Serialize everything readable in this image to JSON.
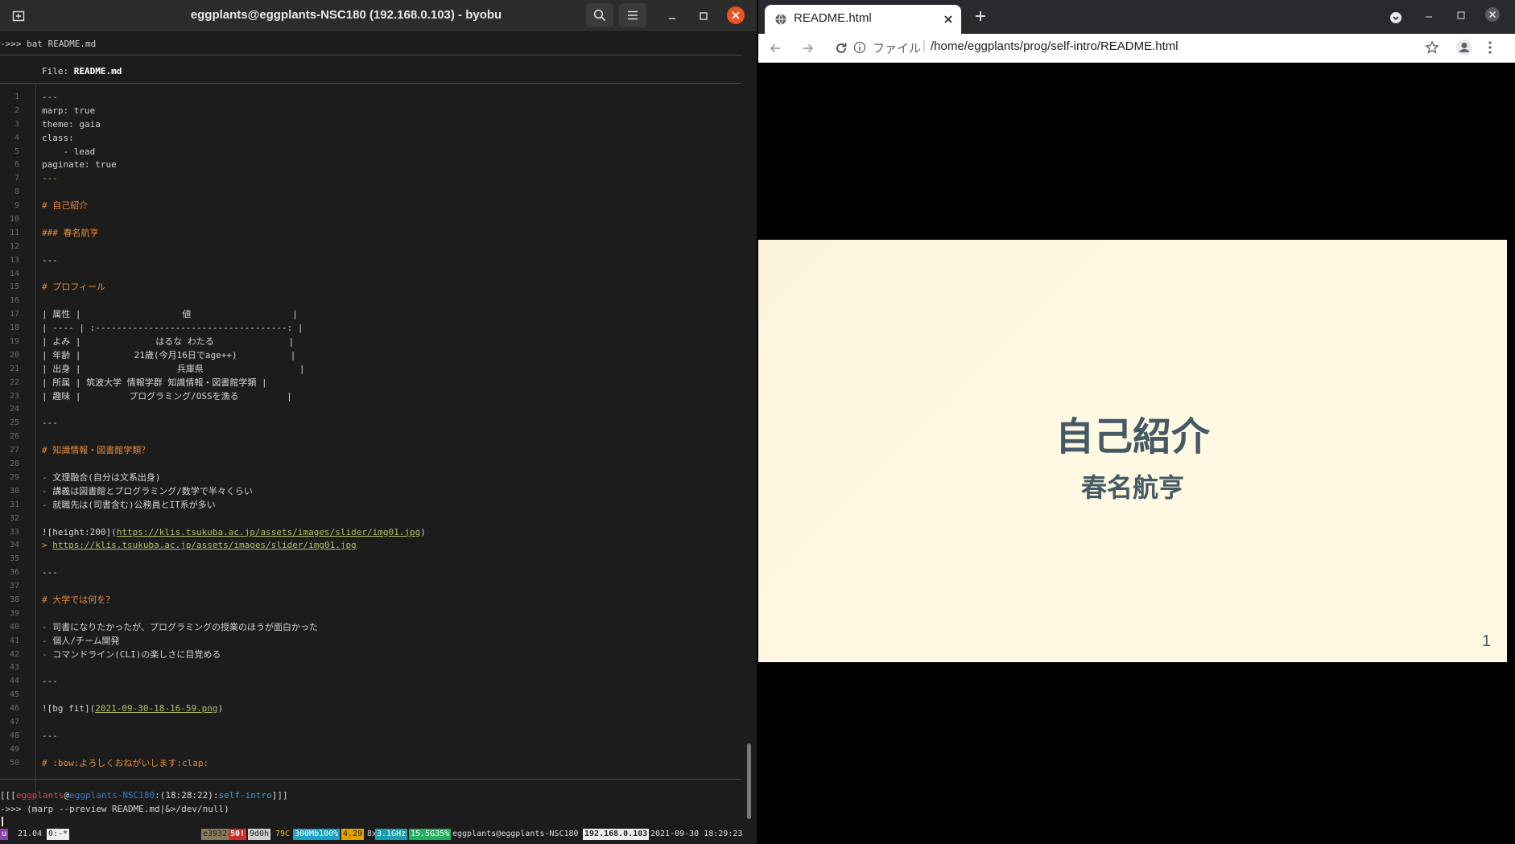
{
  "terminal": {
    "title": "eggplants@eggplants-NSC180 (192.168.0.103) - byobu",
    "command": "->>> bat README.md",
    "file_label": "File: ",
    "file_name": "README.md",
    "lines": [
      {
        "n": "1",
        "t": "---",
        "c": "txt"
      },
      {
        "n": "2",
        "t": "marp: true",
        "c": "txt"
      },
      {
        "n": "3",
        "t": "theme: gaia",
        "c": "txt"
      },
      {
        "n": "4",
        "t": "class:",
        "c": "txt"
      },
      {
        "n": "5",
        "t": "    - lead",
        "c": "txt"
      },
      {
        "n": "6",
        "t": "paginate: true",
        "c": "txt"
      },
      {
        "n": "7",
        "t": "---",
        "c": "dash"
      },
      {
        "n": "8",
        "t": "",
        "c": "txt"
      },
      {
        "n": "9",
        "t": "# 自己紹介",
        "c": "h1"
      },
      {
        "n": "10",
        "t": "",
        "c": "txt"
      },
      {
        "n": "11",
        "t": "### 春名航亨",
        "c": "h1"
      },
      {
        "n": "12",
        "t": "",
        "c": "txt"
      },
      {
        "n": "13",
        "t": "---",
        "c": "txt"
      },
      {
        "n": "14",
        "t": "",
        "c": "txt"
      },
      {
        "n": "15",
        "t": "# プロフィール",
        "c": "h1"
      },
      {
        "n": "16",
        "t": "",
        "c": "txt"
      },
      {
        "n": "17",
        "t": "| 属性 |                   値                   |",
        "c": "txt"
      },
      {
        "n": "18",
        "t": "| ---- | :------------------------------------: |",
        "c": "txt"
      },
      {
        "n": "19",
        "t": "| よみ |              はるな わたる              |",
        "c": "txt"
      },
      {
        "n": "20",
        "t": "| 年齢 |          21歳(今月16日でage++)          |",
        "c": "txt"
      },
      {
        "n": "21",
        "t": "| 出身 |                  兵庫県                  |",
        "c": "txt"
      },
      {
        "n": "22",
        "t": "| 所属 | 筑波大学 情報学群 知識情報・図書館学類 |",
        "c": "txt"
      },
      {
        "n": "23",
        "t": "| 趣味 |         プログラミング/OSSを漁る         |",
        "c": "txt"
      },
      {
        "n": "24",
        "t": "",
        "c": "txt"
      },
      {
        "n": "25",
        "t": "---",
        "c": "txt"
      },
      {
        "n": "26",
        "t": "",
        "c": "txt"
      },
      {
        "n": "27",
        "t": "# 知識情報・図書館学類？",
        "c": "h1"
      },
      {
        "n": "28",
        "t": "",
        "c": "txt"
      },
      {
        "n": "29",
        "t": "- 文理融合(自分は文系出身)",
        "c": "bul"
      },
      {
        "n": "30",
        "t": "- 講義は図書館とプログラミング/数学で半々くらい",
        "c": "bul"
      },
      {
        "n": "31",
        "t": "- 就職先は(司書含む)公務員とIT系が多い",
        "c": "bul"
      },
      {
        "n": "32",
        "t": "",
        "c": "txt"
      },
      {
        "n": "33",
        "t": "![height:200](https://klis.tsukuba.ac.jp/assets/images/slider/img01.jpg)",
        "c": "img"
      },
      {
        "n": "34",
        "t": "> https://klis.tsukuba.ac.jp/assets/images/slider/img01.jpg",
        "c": "quote"
      },
      {
        "n": "35",
        "t": "",
        "c": "txt"
      },
      {
        "n": "36",
        "t": "---",
        "c": "txt"
      },
      {
        "n": "37",
        "t": "",
        "c": "txt"
      },
      {
        "n": "38",
        "t": "# 大学では何を？",
        "c": "h1"
      },
      {
        "n": "39",
        "t": "",
        "c": "txt"
      },
      {
        "n": "40",
        "t": "- 司書になりたかったが、プログラミングの授業のほうが面白かった",
        "c": "bul"
      },
      {
        "n": "41",
        "t": "- 個人/チーム開発",
        "c": "bul"
      },
      {
        "n": "42",
        "t": "- コマンドライン(CLI)の楽しさに目覚める",
        "c": "bul"
      },
      {
        "n": "43",
        "t": "",
        "c": "txt"
      },
      {
        "n": "44",
        "t": "---",
        "c": "txt"
      },
      {
        "n": "45",
        "t": "",
        "c": "txt"
      },
      {
        "n": "46",
        "t": "![bg fit](2021-09-30-18-16-59.png)",
        "c": "img2"
      },
      {
        "n": "47",
        "t": "",
        "c": "txt"
      },
      {
        "n": "48",
        "t": "---",
        "c": "txt"
      },
      {
        "n": "49",
        "t": "",
        "c": "txt"
      },
      {
        "n": "50",
        "t": "# :bow:よろしくおねがいします:clap:",
        "c": "h1"
      }
    ],
    "prompt_user": "eggplants",
    "prompt_at": "@",
    "prompt_host": "eggplants-NSC180",
    "prompt_time": ":(18:28:22):",
    "prompt_dir": "self-intro",
    "prompt_open": "[[[",
    "prompt_close": "]]]",
    "command2": "->>> (marp --preview README.md|&>/dev/null)",
    "status": {
      "u": "u",
      "version": "21.04",
      "win": "0:-*",
      "mem_id": "e3932",
      "updates": "50!",
      "uptime": "9d0h",
      "temp": "79C",
      "net": "300Mb100%",
      "load": "4.29",
      "cpu_count": "8x",
      "freq": "3.1GHz",
      "mem": "15.5G35%",
      "userhost": "eggplants@eggplants-NSC180",
      "ip": "192.168.0.103",
      "datetime": "2021-09-30 18:29:23"
    }
  },
  "browser": {
    "tab_title": "README.html",
    "url_label": "ファイル",
    "url_sep": "|",
    "url": "/home/eggplants/prog/self-intro/README.html",
    "slide": {
      "title": "自己紹介",
      "subtitle": "春名航亨",
      "page": "1"
    }
  }
}
